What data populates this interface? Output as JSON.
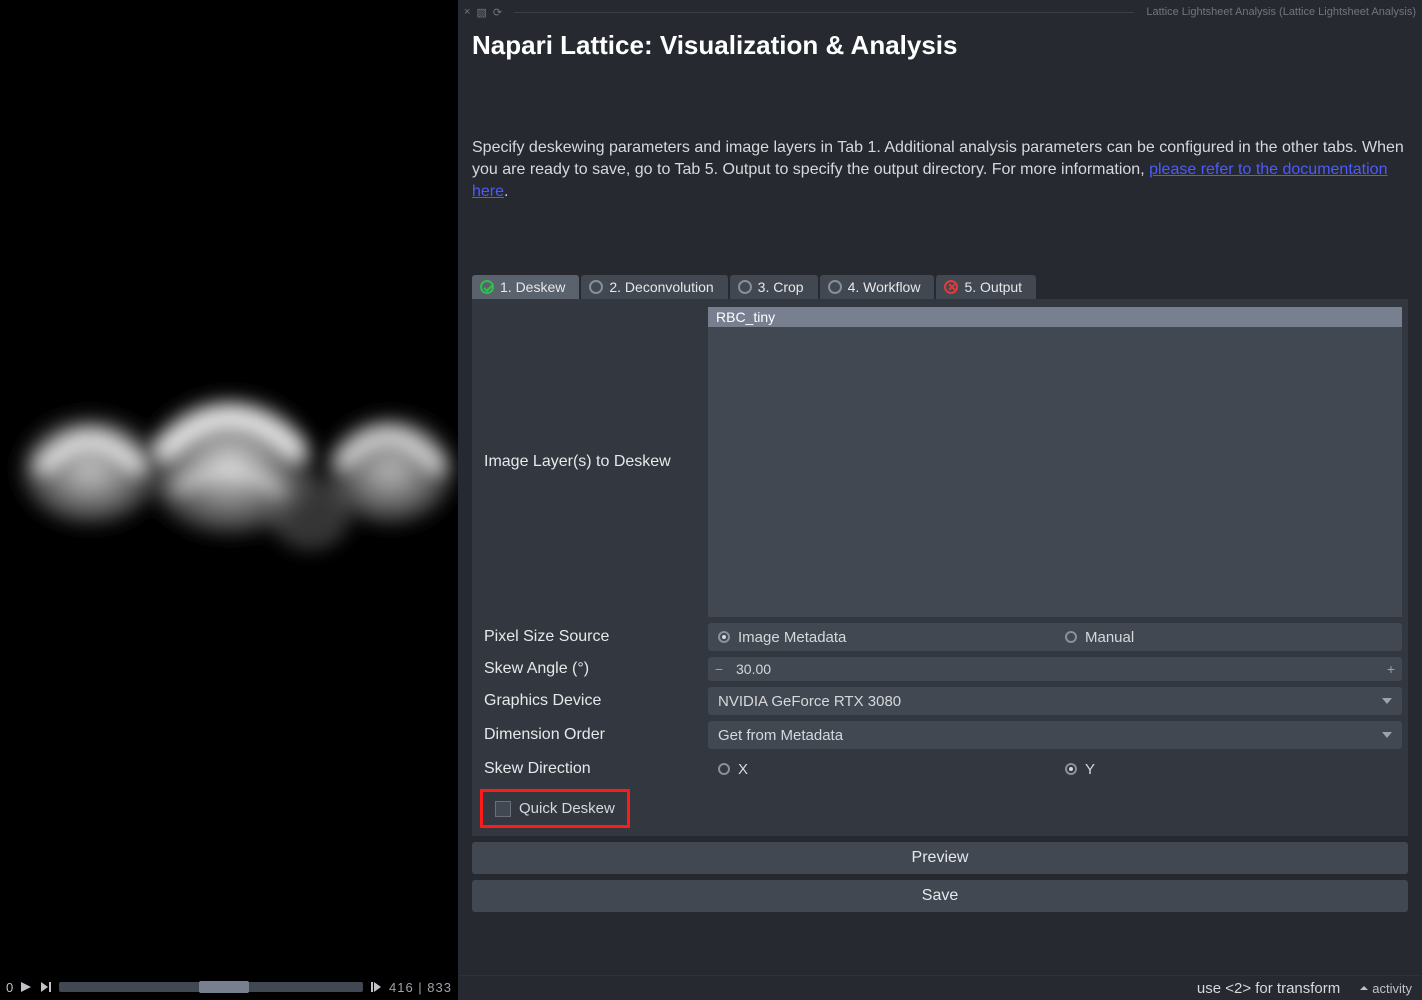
{
  "dock": {
    "title": "Lattice Lightsheet Analysis (Lattice Lightsheet Analysis)"
  },
  "plugin": {
    "title": "Napari Lattice: Visualization & Analysis",
    "description_pre": "Specify deskewing parameters and image layers in Tab 1.  Additional analysis parameters can be configured in the other tabs.  When you are ready to save, go to Tab 5.  Output to specify the output directory.  For more information, ",
    "description_link": "please refer to the documentation here",
    "description_post": "."
  },
  "tabs": [
    {
      "label": "1. Deskew",
      "state": "ok",
      "active": true
    },
    {
      "label": "2. Deconvolution",
      "state": "none",
      "active": false
    },
    {
      "label": "3. Crop",
      "state": "none",
      "active": false
    },
    {
      "label": "4. Workflow",
      "state": "none",
      "active": false
    },
    {
      "label": "5. Output",
      "state": "err",
      "active": false
    }
  ],
  "form": {
    "layers_label": "Image Layer(s) to Deskew",
    "layers": [
      "RBC_tiny"
    ],
    "pixel_label": "Pixel Size Source",
    "pixel_options": [
      "Image Metadata",
      "Manual"
    ],
    "pixel_selected": 0,
    "angle_label": "Skew Angle (°)",
    "angle_value": "30.00",
    "gpu_label": "Graphics Device",
    "gpu_value": "NVIDIA GeForce RTX 3080",
    "dim_label": "Dimension Order",
    "dim_value": "Get from Metadata",
    "dir_label": "Skew Direction",
    "dir_options": [
      "X",
      "Y"
    ],
    "dir_selected": 1,
    "quick_label": "Quick Deskew"
  },
  "buttons": {
    "preview": "Preview",
    "save": "Save"
  },
  "slider": {
    "index": "0",
    "pos": "416",
    "total": "833"
  },
  "status": {
    "hint": "use <2> for transform",
    "activity": "activity"
  }
}
